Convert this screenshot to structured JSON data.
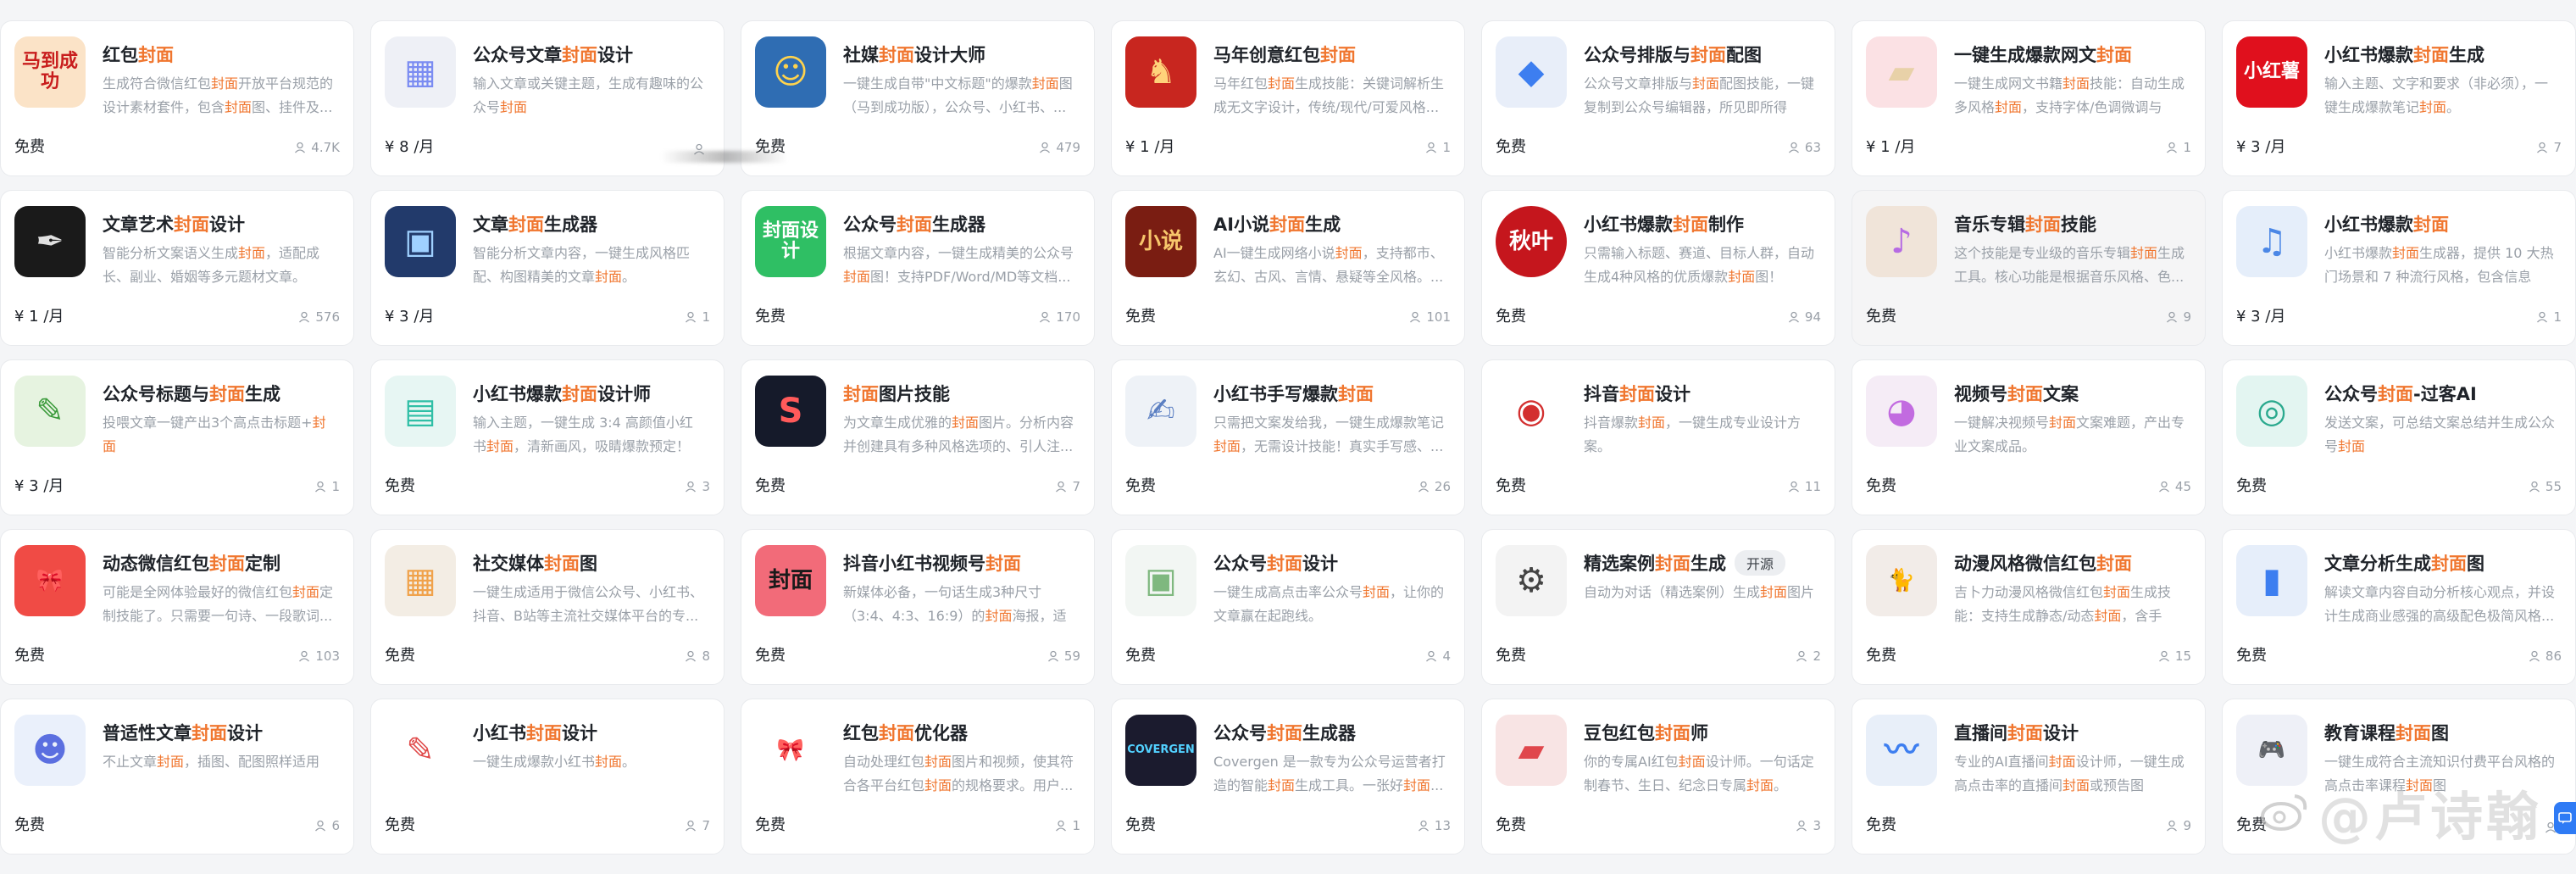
{
  "cards": [
    {
      "title": [
        [
          "红包",
          ""
        ],
        [
          "封面",
          "hl"
        ]
      ],
      "desc": [
        [
          "生成符合微信红包",
          ""
        ],
        [
          "封面",
          "hl"
        ],
        [
          "开放平台规范的设计素材套件，包含",
          ""
        ],
        [
          "封面",
          "hl"
        ],
        [
          "图、挂件及...",
          ""
        ]
      ],
      "price": "免费",
      "users": "4.7K",
      "icon": {
        "name": "horse-success-icon",
        "bg": "#fbe3c7",
        "text": "马到成功",
        "color": "#c81d1d"
      }
    },
    {
      "title": [
        [
          "公众号文章",
          ""
        ],
        [
          "封面",
          "hl"
        ],
        [
          "设计",
          ""
        ]
      ],
      "desc": [
        [
          "输入文章或关键主题，生成有趣味的公众号",
          ""
        ],
        [
          "封面",
          "hl"
        ]
      ],
      "price": "¥ 8 /月",
      "users": "",
      "icon": {
        "name": "stack-3d-icon",
        "bg": "#eef0f6",
        "text": "▦",
        "color": "#7b8cf2"
      }
    },
    {
      "title": [
        [
          "社媒",
          ""
        ],
        [
          "封面",
          "hl"
        ],
        [
          "设计大师",
          ""
        ]
      ],
      "desc": [
        [
          "一键生成自带\"中文标题\"的爆款",
          ""
        ],
        [
          "封面",
          "hl"
        ],
        [
          "图（马到成功版），公众号、小红书、...",
          ""
        ]
      ],
      "price": "免费",
      "users": "479",
      "icon": {
        "name": "cartoon-man-icon",
        "bg": "#2f6db3",
        "text": "☺",
        "color": "#ffd34d"
      }
    },
    {
      "title": [
        [
          "马年创意红包",
          ""
        ],
        [
          "封面",
          "hl"
        ]
      ],
      "desc": [
        [
          "马年红包",
          ""
        ],
        [
          "封面",
          "hl"
        ],
        [
          "生成技能：关键词解析生成无文字设计，传统/现代/可爱风格...",
          ""
        ]
      ],
      "price": "¥ 1 /月",
      "users": "1",
      "icon": {
        "name": "red-horse-icon",
        "bg": "#c8261f",
        "text": "♞",
        "color": "#ffd27a"
      }
    },
    {
      "title": [
        [
          "公众号排版与",
          ""
        ],
        [
          "封面",
          "hl"
        ],
        [
          "配图",
          ""
        ]
      ],
      "desc": [
        [
          "公众号文章排版与",
          ""
        ],
        [
          "封面",
          "hl"
        ],
        [
          "配图技能，一键复制到公众号编辑器，所见即所得",
          ""
        ]
      ],
      "price": "免费",
      "users": "63",
      "icon": {
        "name": "blue-shape-icon",
        "bg": "#e8eef9",
        "text": "◆",
        "color": "#3d7ef0"
      }
    },
    {
      "title": [
        [
          "一键生成爆款网文",
          ""
        ],
        [
          "封面",
          "hl"
        ]
      ],
      "desc": [
        [
          "一键生成网文书籍",
          ""
        ],
        [
          "封面",
          "hl"
        ],
        [
          "技能：自动生成多风格",
          ""
        ],
        [
          "封面",
          "hl"
        ],
        [
          "，支持字体/色调微调与构...",
          ""
        ]
      ],
      "price": "¥ 1 /月",
      "users": "1",
      "icon": {
        "name": "book-block-icon",
        "bg": "#fbe1e4",
        "text": "▰",
        "color": "#e8d1a8"
      }
    },
    {
      "title": [
        [
          "小红书爆款",
          ""
        ],
        [
          "封面",
          "hl"
        ],
        [
          "生成",
          ""
        ]
      ],
      "desc": [
        [
          "输入主题、文字和要求（非必须），一键生成爆款笔记",
          ""
        ],
        [
          "封面",
          "hl"
        ],
        [
          "。",
          ""
        ]
      ],
      "price": "¥ 3 /月",
      "users": "7",
      "icon": {
        "name": "xiaohongshu-logo-icon",
        "bg": "#e0101d",
        "text": "小红薯",
        "color": "#ffffff"
      }
    },
    {
      "title": [
        [
          "文章艺术",
          ""
        ],
        [
          "封面",
          "hl"
        ],
        [
          "设计",
          ""
        ]
      ],
      "desc": [
        [
          "智能分析文案语义生成",
          ""
        ],
        [
          "封面",
          "hl"
        ],
        [
          "，适配成长、副业、婚姻等多元题材文章。",
          ""
        ]
      ],
      "price": "¥ 1 /月",
      "users": "576",
      "icon": {
        "name": "pen-art-icon",
        "bg": "#1a1a1a",
        "text": "✒",
        "color": "#e0e0e0"
      }
    },
    {
      "title": [
        [
          "文章",
          ""
        ],
        [
          "封面",
          "hl"
        ],
        [
          "生成器",
          ""
        ]
      ],
      "desc": [
        [
          "智能分析文章内容，一键生成风格匹配、构图精美的文章",
          ""
        ],
        [
          "封面",
          "hl"
        ],
        [
          "。",
          ""
        ]
      ],
      "price": "¥ 3 /月",
      "users": "1",
      "icon": {
        "name": "city-night-icon",
        "bg": "#223a6b",
        "text": "▣",
        "color": "#9fd0ff"
      }
    },
    {
      "title": [
        [
          "公众号",
          ""
        ],
        [
          "封面",
          "hl"
        ],
        [
          "生成器",
          ""
        ]
      ],
      "desc": [
        [
          "根据文章内容，一键生成精美的公众号",
          ""
        ],
        [
          "封面",
          "hl"
        ],
        [
          "图！支持PDF/Word/MD等文档...",
          ""
        ]
      ],
      "price": "免费",
      "users": "170",
      "icon": {
        "name": "green-brush-icon",
        "bg": "#2fbf64",
        "text": "封面设计",
        "color": "#ffffff"
      }
    },
    {
      "title": [
        [
          "AI小说",
          ""
        ],
        [
          "封面",
          "hl"
        ],
        [
          "生成",
          ""
        ]
      ],
      "desc": [
        [
          "AI一键生成网络小说",
          ""
        ],
        [
          "封面",
          "hl"
        ],
        [
          "，支持都市、玄幻、古风、言情、悬疑等全风格。...",
          ""
        ]
      ],
      "price": "免费",
      "users": "101",
      "icon": {
        "name": "novel-cover-icon",
        "bg": "#7a1d12",
        "text": "小说",
        "color": "#f7c66b"
      }
    },
    {
      "title": [
        [
          "小红书爆款",
          ""
        ],
        [
          "封面",
          "hl"
        ],
        [
          "制作",
          ""
        ]
      ],
      "desc": [
        [
          "只需输入标题、赛道、目标人群，自动生成4种风格的优质爆款",
          ""
        ],
        [
          "封面",
          "hl"
        ],
        [
          "图！",
          ""
        ]
      ],
      "price": "免费",
      "users": "94",
      "icon": {
        "name": "autumn-leaf-logo-icon",
        "bg": "#c5161d",
        "text": "秋叶",
        "color": "#ffffff",
        "round": true
      }
    },
    {
      "title": [
        [
          "音乐专辑",
          ""
        ],
        [
          "封面",
          "hl"
        ],
        [
          "技能",
          ""
        ]
      ],
      "desc": [
        [
          "这个技能是专业级的音乐专辑",
          ""
        ],
        [
          "封面",
          "hl"
        ],
        [
          "生成工具。核心功能是根据音乐风格、色...",
          ""
        ]
      ],
      "price": "免费",
      "users": "9",
      "active": true,
      "icon": {
        "name": "music-note-icon",
        "bg": "#f0e4d9",
        "text": "♪",
        "color": "#b66be3"
      }
    },
    {
      "title": [
        [
          "小红书爆款",
          ""
        ],
        [
          "封面",
          "hl"
        ]
      ],
      "desc": [
        [
          "小红书爆款",
          ""
        ],
        [
          "封面",
          "hl"
        ],
        [
          "生成器，提供 10 大热门场景和 7 种流行风格，包含信息图...",
          ""
        ]
      ],
      "price": "¥ 3 /月",
      "users": "1",
      "icon": {
        "name": "guitar-icon",
        "bg": "#e5eefa",
        "text": "♫",
        "color": "#4b87e6"
      }
    },
    {
      "title": [
        [
          "公众号标题与",
          ""
        ],
        [
          "封面",
          "hl"
        ],
        [
          "生成",
          ""
        ]
      ],
      "desc": [
        [
          "投喂文章一键产出3个高点击标题+",
          ""
        ],
        [
          "封面",
          "hl"
        ]
      ],
      "price": "¥ 3 /月",
      "users": "1",
      "icon": {
        "name": "mascot-writer-icon",
        "bg": "#e6f3e0",
        "text": "✎",
        "color": "#3c9b3c"
      }
    },
    {
      "title": [
        [
          "小红书爆款",
          ""
        ],
        [
          "封面",
          "hl"
        ],
        [
          "设计师",
          ""
        ]
      ],
      "desc": [
        [
          "输入主题，一键生成 3:4 高颜值小红书",
          ""
        ],
        [
          "封面",
          "hl"
        ],
        [
          "，清新画风，吸睛爆款预定！",
          ""
        ]
      ],
      "price": "免费",
      "users": "3",
      "icon": {
        "name": "teal-box-icon",
        "bg": "#e7f6f3",
        "text": "▤",
        "color": "#2fbfa6"
      }
    },
    {
      "title": [
        [
          "封面",
          "hl"
        ],
        [
          "图片技能",
          ""
        ]
      ],
      "desc": [
        [
          "为文章生成优雅的",
          ""
        ],
        [
          "封面",
          "hl"
        ],
        [
          "图片。分析内容并创建具有多种风格选项的、引人注...",
          ""
        ]
      ],
      "price": "免费",
      "users": "7",
      "icon": {
        "name": "dark-s-logo-icon",
        "bg": "#151a2a",
        "text": "S",
        "color": "#ff5a5a"
      }
    },
    {
      "title": [
        [
          "小红书手写爆款",
          ""
        ],
        [
          "封面",
          "hl"
        ]
      ],
      "desc": [
        [
          "只需把文案发给我，一键生成爆款笔记",
          ""
        ],
        [
          "封面",
          "hl"
        ],
        [
          "，无需设计技能！真实手写感、...",
          ""
        ]
      ],
      "price": "免费",
      "users": "26",
      "icon": {
        "name": "hand-writing-icon",
        "bg": "#eef2f7",
        "text": "✍",
        "color": "#5b7fc2"
      }
    },
    {
      "title": [
        [
          "抖音",
          ""
        ],
        [
          "封面",
          "hl"
        ],
        [
          "设计",
          ""
        ]
      ],
      "desc": [
        [
          "抖音爆款",
          ""
        ],
        [
          "封面",
          "hl"
        ],
        [
          "，一键生成专业设计方案。",
          ""
        ]
      ],
      "price": "免费",
      "users": "11",
      "icon": {
        "name": "douyin-cover-icon",
        "bg": "#ffffff",
        "text": "◉",
        "color": "#d32f2f"
      }
    },
    {
      "title": [
        [
          "视频号",
          ""
        ],
        [
          "封面",
          "hl"
        ],
        [
          "文案",
          ""
        ]
      ],
      "desc": [
        [
          "一键解决视频号",
          ""
        ],
        [
          "封面",
          "hl"
        ],
        [
          "文案难题，产出专业文案成品。",
          ""
        ]
      ],
      "price": "免费",
      "users": "45",
      "icon": {
        "name": "pink-robot-icon",
        "bg": "#f5ecf6",
        "text": "◕",
        "color": "#c26be0"
      }
    },
    {
      "title": [
        [
          "公众号",
          ""
        ],
        [
          "封面",
          "hl"
        ],
        [
          "-过客AI",
          ""
        ]
      ],
      "desc": [
        [
          "发送文案，可总结文案总结并生成公众号",
          ""
        ],
        [
          "封面",
          "hl"
        ]
      ],
      "price": "免费",
      "users": "55",
      "icon": {
        "name": "teal-disc-icon",
        "bg": "#e3f5f1",
        "text": "◎",
        "color": "#2aa98e"
      }
    },
    {
      "title": [
        [
          "动态微信红包",
          ""
        ],
        [
          "封面",
          "hl"
        ],
        [
          "定制",
          ""
        ]
      ],
      "desc": [
        [
          "可能是全网体验最好的微信红包",
          ""
        ],
        [
          "封面",
          "hl"
        ],
        [
          "定制技能了。只需要一句诗、一段歌词...",
          ""
        ]
      ],
      "price": "免费",
      "users": "103",
      "icon": {
        "name": "red-ribbon-icon",
        "bg": "#f04b45",
        "text": "🎀",
        "color": "#ffffff"
      }
    },
    {
      "title": [
        [
          "社交媒体",
          ""
        ],
        [
          "封面",
          "hl"
        ],
        [
          "图",
          ""
        ]
      ],
      "desc": [
        [
          "一键生成适用于微信公众号、小红书、抖音、B站等主流社交媒体平台的专...",
          ""
        ]
      ],
      "price": "免费",
      "users": "8",
      "icon": {
        "name": "orange-stack-icon",
        "bg": "#f3ede4",
        "text": "▦",
        "color": "#f0a24b"
      }
    },
    {
      "title": [
        [
          "抖音小红书视频号",
          ""
        ],
        [
          "封面",
          "hl"
        ]
      ],
      "desc": [
        [
          "新媒体必备，一句话生成3种尺寸（3:4、4:3、16:9）的",
          ""
        ],
        [
          "封面",
          "hl"
        ],
        [
          "海报，适配...",
          ""
        ]
      ],
      "price": "免费",
      "users": "59",
      "icon": {
        "name": "poster-sizes-icon",
        "bg": "#f26b79",
        "text": "封面",
        "color": "#1a1a1a"
      }
    },
    {
      "title": [
        [
          "公众号",
          ""
        ],
        [
          "封面",
          "hl"
        ],
        [
          "设计",
          ""
        ]
      ],
      "desc": [
        [
          "一键生成高点击率公众号",
          ""
        ],
        [
          "封面",
          "hl"
        ],
        [
          "，让你的文章赢在起跑线。",
          ""
        ]
      ],
      "price": "免费",
      "users": "4",
      "icon": {
        "name": "mini-layout-icon",
        "bg": "#f2f6f3",
        "text": "▣",
        "color": "#7fb87f"
      }
    },
    {
      "title": [
        [
          "精选案例",
          ""
        ],
        [
          "封面",
          "hl"
        ],
        [
          "生成",
          ""
        ]
      ],
      "desc": [
        [
          "自动为对话（精选案例）生成",
          ""
        ],
        [
          "封面",
          "hl"
        ],
        [
          "图片",
          ""
        ]
      ],
      "price": "免费",
      "users": "2",
      "tag": "开源",
      "icon": {
        "name": "gear-cover-icon",
        "bg": "#f3f3f3",
        "text": "⚙",
        "color": "#444"
      }
    },
    {
      "title": [
        [
          "动漫风格微信红包",
          ""
        ],
        [
          "封面",
          "hl"
        ]
      ],
      "desc": [
        [
          "吉卜力动漫风格微信红包",
          ""
        ],
        [
          "封面",
          "hl"
        ],
        [
          "生成技能：支持生成静态/动态",
          ""
        ],
        [
          "封面",
          "hl"
        ],
        [
          "，含手绘...",
          ""
        ]
      ],
      "price": "免费",
      "users": "15",
      "icon": {
        "name": "black-cat-icon",
        "bg": "#f2ece8",
        "text": "🐈",
        "color": "#222"
      }
    },
    {
      "title": [
        [
          "文章分析生成",
          ""
        ],
        [
          "封面",
          "hl"
        ],
        [
          "图",
          ""
        ]
      ],
      "desc": [
        [
          "解读文章内容自动分析核心观点，并设计生成商业感强的高级配色极简风格...",
          ""
        ]
      ],
      "price": "免费",
      "users": "86",
      "icon": {
        "name": "bar-chart-icon",
        "bg": "#e6eefa",
        "text": "▮",
        "color": "#3d7ef0"
      }
    },
    {
      "title": [
        [
          "普适性文章",
          ""
        ],
        [
          "封面",
          "hl"
        ],
        [
          "设计",
          ""
        ]
      ],
      "desc": [
        [
          "不止文章",
          ""
        ],
        [
          "封面",
          "hl"
        ],
        [
          "，插图、配图照样适用",
          ""
        ]
      ],
      "price": "免费",
      "users": "6",
      "icon": {
        "name": "blue-mascot-icon",
        "bg": "#eaf0fb",
        "text": "☻",
        "color": "#5b6fe0"
      }
    },
    {
      "title": [
        [
          "小红书",
          ""
        ],
        [
          "封面",
          "hl"
        ],
        [
          "设计",
          ""
        ]
      ],
      "desc": [
        [
          "一键生成爆款小红书",
          ""
        ],
        [
          "封面",
          "hl"
        ],
        [
          "。",
          ""
        ]
      ],
      "price": "免费",
      "users": "7",
      "icon": {
        "name": "red-doc-icon",
        "bg": "#ffffff",
        "text": "✎",
        "color": "#e04a4a"
      }
    },
    {
      "title": [
        [
          "红包",
          ""
        ],
        [
          "封面",
          "hl"
        ],
        [
          "优化器",
          ""
        ]
      ],
      "desc": [
        [
          "自动处理红包",
          ""
        ],
        [
          "封面",
          "hl"
        ],
        [
          "图片和视频，使其符合各平台红包",
          ""
        ],
        [
          "封面",
          "hl"
        ],
        [
          "的规格要求。用户...",
          ""
        ]
      ],
      "price": "免费",
      "users": "1",
      "icon": {
        "name": "red-envelope-bow-icon",
        "bg": "#ffffff",
        "text": "🎀",
        "color": "#e53935"
      }
    },
    {
      "title": [
        [
          "公众号",
          ""
        ],
        [
          "封面",
          "hl"
        ],
        [
          "生成器",
          ""
        ]
      ],
      "desc": [
        [
          "Covergen 是一款专为公众号运营者打造的智能",
          ""
        ],
        [
          "封面",
          "hl"
        ],
        [
          "生成工具。一张好",
          ""
        ],
        [
          "封面",
          "hl"
        ],
        [
          "...",
          ""
        ]
      ],
      "price": "免费",
      "users": "13",
      "icon": {
        "name": "covergen-logo-icon",
        "bg": "#1b1b2e",
        "text": "COVERGEN",
        "color": "#52d1ff"
      }
    },
    {
      "title": [
        [
          "豆包红包",
          ""
        ],
        [
          "封面",
          "hl"
        ],
        [
          "师",
          ""
        ]
      ],
      "desc": [
        [
          "你的专属AI红包",
          ""
        ],
        [
          "封面",
          "hl"
        ],
        [
          "设计师。一句话定制春节、生日、纪念日专属",
          ""
        ],
        [
          "封面",
          "hl"
        ],
        [
          "。",
          ""
        ]
      ],
      "price": "免费",
      "users": "3",
      "icon": {
        "name": "red-pouch-icon",
        "bg": "#f8e4e4",
        "text": "▰",
        "color": "#e0474c"
      }
    },
    {
      "title": [
        [
          "直播间",
          ""
        ],
        [
          "封面",
          "hl"
        ],
        [
          "设计",
          ""
        ]
      ],
      "desc": [
        [
          "专业的AI直播间",
          ""
        ],
        [
          "封面",
          "hl"
        ],
        [
          "设计师，一键生成高点击率的直播间",
          ""
        ],
        [
          "封面",
          "hl"
        ],
        [
          "或预告图",
          ""
        ]
      ],
      "price": "免费",
      "users": "9",
      "icon": {
        "name": "blue-wave-icon",
        "bg": "#e8eff9",
        "text": "〰",
        "color": "#3d7ef0"
      }
    },
    {
      "title": [
        [
          "教育课程",
          ""
        ],
        [
          "封面",
          "hl"
        ],
        [
          "图",
          ""
        ]
      ],
      "desc": [
        [
          "一键生成符合主流知识付费平台风格的高点击率课程",
          ""
        ],
        [
          "封面",
          "hl"
        ],
        [
          "图",
          ""
        ]
      ],
      "price": "免费",
      "users": "",
      "icon": {
        "name": "game-controller-icon",
        "bg": "#eef0f7",
        "text": "🎮",
        "color": "#6a7ae0"
      }
    }
  ],
  "watermark": {
    "text": "@卢诗翰"
  }
}
